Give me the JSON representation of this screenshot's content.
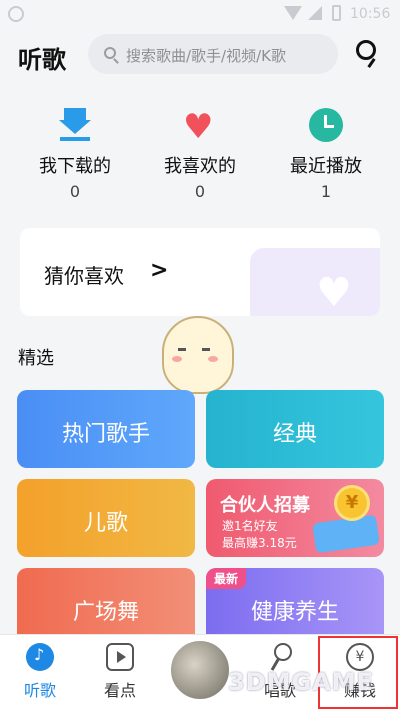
{
  "statusbar": {
    "time": "10:56"
  },
  "header": {
    "title": "听歌",
    "search_placeholder": "搜索歌曲/歌手/视频/K歌"
  },
  "quick": [
    {
      "label": "我下载的",
      "count": "0"
    },
    {
      "label": "我喜欢的",
      "count": "0"
    },
    {
      "label": "最近播放",
      "count": "1"
    }
  ],
  "guess": {
    "label": "猜你喜欢",
    "chevron": ">"
  },
  "section": {
    "title": "精选"
  },
  "tiles": {
    "hot_singers": "热门歌手",
    "classic": "经典",
    "kids": "儿歌",
    "promo": {
      "title": "合伙人招募",
      "line1": "邀1名好友",
      "line2": "最高赚3.18元",
      "coin": "¥"
    },
    "square_dance": "广场舞",
    "health": {
      "label": "健康养生",
      "badge": "最新"
    }
  },
  "tabbar": {
    "listen": "听歌",
    "watch": "看点",
    "sing": "唱歌",
    "earn": "赚钱",
    "earn_icon": "¥"
  },
  "watermark": "3DMGAME",
  "colors": {
    "accent": "#1e88e5",
    "highlight": "#e33333"
  }
}
